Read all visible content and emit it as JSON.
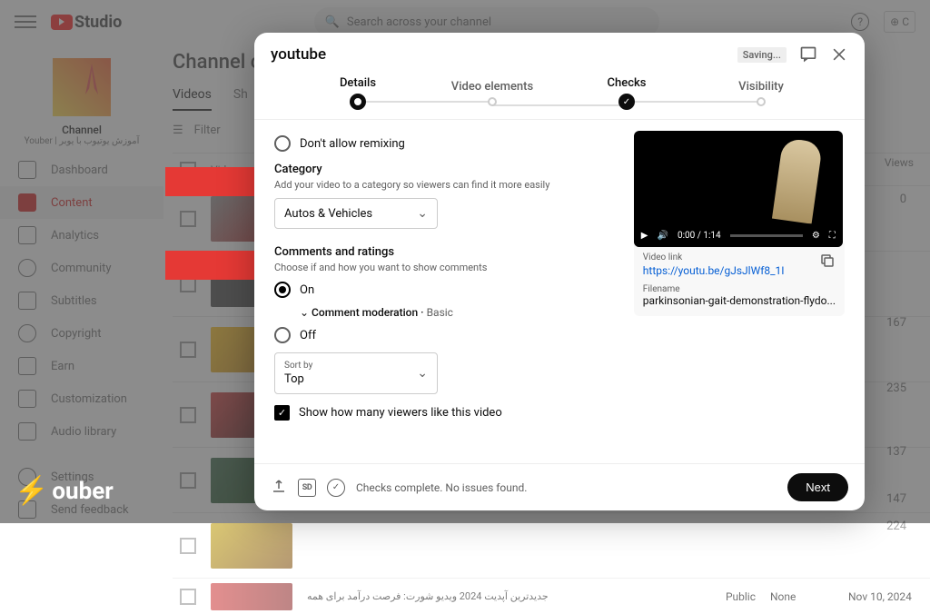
{
  "bg": {
    "studio_label": "Studio",
    "search_placeholder": "Search across your channel",
    "channel_label": "Channel",
    "channel_sub": "Youber | آموزش یوتیوب با یوبر",
    "content_header": "Channel c",
    "tabs": {
      "videos": "Videos",
      "shorts": "Sh"
    },
    "filter": "Filter",
    "col_video": "Video",
    "col_views": "Views",
    "sidebar": [
      "Dashboard",
      "Content",
      "Analytics",
      "Community",
      "Subtitles",
      "Copyright",
      "Earn",
      "Customization",
      "Audio library"
    ],
    "sidebar_bottom": [
      "Settings",
      "Send feedback"
    ],
    "rows": [
      {
        "views": "0"
      },
      {
        "views": ""
      },
      {
        "views": "167"
      },
      {
        "views": "235"
      },
      {
        "views": "137"
      },
      {
        "views": "147"
      },
      {
        "views": "224"
      }
    ],
    "bottom_meta": {
      "title": "جدیدترین آپدیت 2024 ویدیو شورت: فرصت درآمد برای همه",
      "visibility": "Public",
      "restrict": "None",
      "date": "Nov 10, 2024"
    },
    "watermark": "ouber"
  },
  "modal": {
    "title": "youtube",
    "saving": "Saving...",
    "steps": [
      "Details",
      "Video elements",
      "Checks",
      "Visibility"
    ],
    "remix_label": "Don't allow remixing",
    "category": {
      "label": "Category",
      "desc": "Add your video to a category so viewers can find it more easily",
      "value": "Autos & Vehicles"
    },
    "comments": {
      "label": "Comments and ratings",
      "desc": "Choose if and how you want to show comments",
      "on": "On",
      "off": "Off"
    },
    "moderation": {
      "label": "Comment moderation",
      "value": "Basic"
    },
    "sort": {
      "label": "Sort by",
      "value": "Top"
    },
    "likes_label": "Show how many viewers like this video",
    "player": {
      "time": "0:00 / 1:14"
    },
    "link": {
      "label": "Video link",
      "url": "https://youtu.be/gJsJlWf8_1I"
    },
    "filename": {
      "label": "Filename",
      "value": "parkinsonian-gait-demonstration-flydo..."
    },
    "footer_msg": "Checks complete. No issues found.",
    "sd": "SD",
    "next": "Next"
  }
}
